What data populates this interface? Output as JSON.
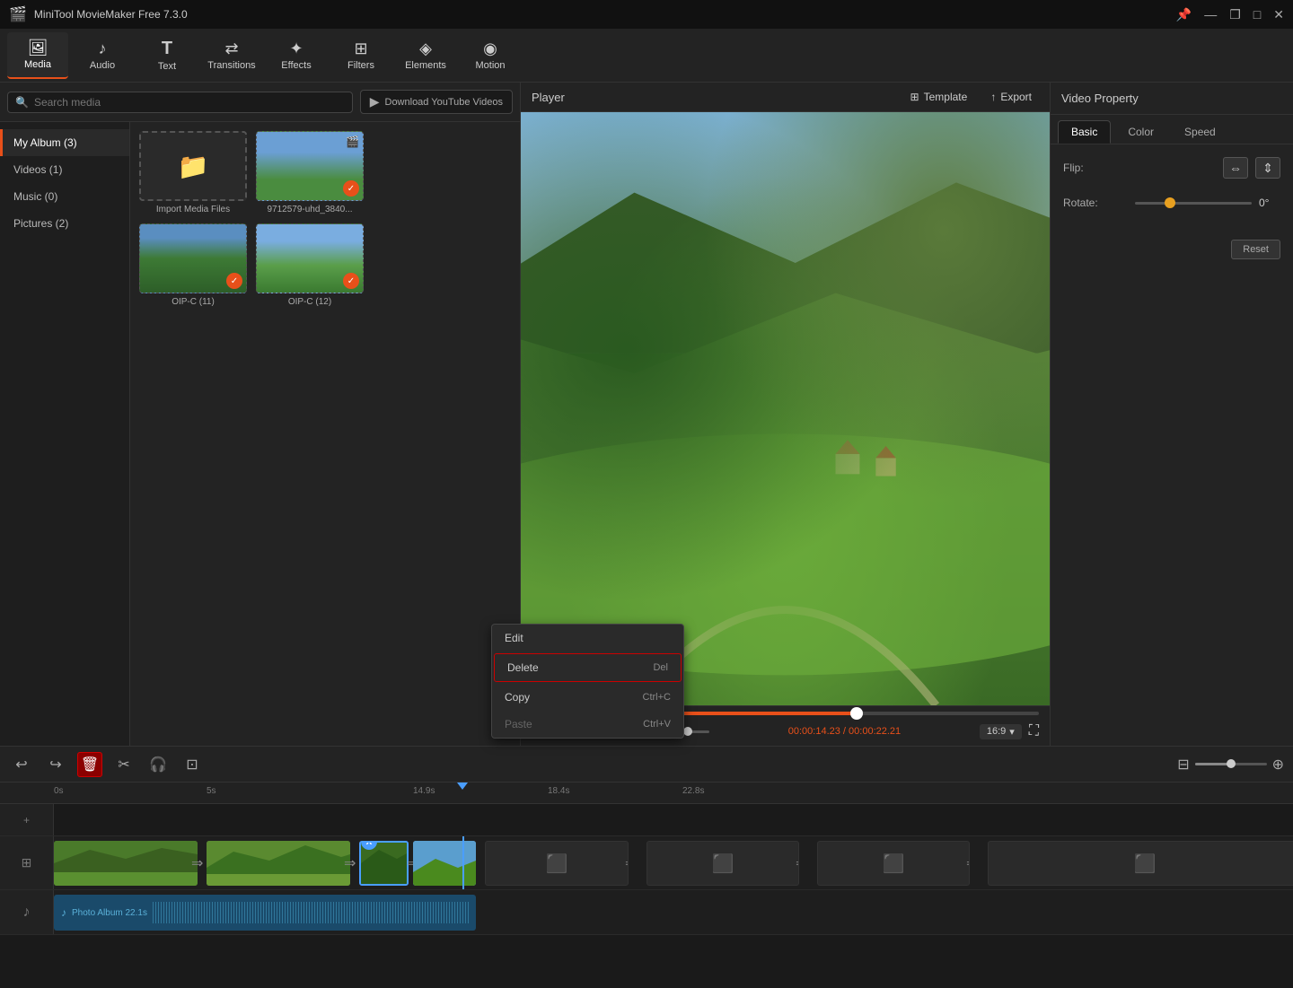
{
  "app": {
    "title": "MiniTool MovieMaker Free 7.3.0",
    "icon": "🎬"
  },
  "titlebar": {
    "minimize": "—",
    "maximize": "□",
    "restore": "❐",
    "close": "✕",
    "pin_icon": "📌"
  },
  "toolbar": {
    "items": [
      {
        "id": "media",
        "label": "Media",
        "icon": "🖼"
      },
      {
        "id": "audio",
        "label": "Audio",
        "icon": "♪"
      },
      {
        "id": "text",
        "label": "Text",
        "icon": "T"
      },
      {
        "id": "transitions",
        "label": "Transitions",
        "icon": "⇄"
      },
      {
        "id": "effects",
        "label": "Effects",
        "icon": "✦"
      },
      {
        "id": "filters",
        "label": "Filters",
        "icon": "⊞"
      },
      {
        "id": "elements",
        "label": "Elements",
        "icon": "◈"
      },
      {
        "id": "motion",
        "label": "Motion",
        "icon": "◉"
      }
    ]
  },
  "search": {
    "placeholder": "Search media"
  },
  "download_yt": {
    "label": "Download YouTube Videos",
    "icon": "▶"
  },
  "sidebar": {
    "items": [
      {
        "id": "my-album",
        "label": "My Album (3)"
      },
      {
        "id": "videos",
        "label": "Videos (1)"
      },
      {
        "id": "music",
        "label": "Music (0)"
      },
      {
        "id": "pictures",
        "label": "Pictures (2)"
      }
    ]
  },
  "media_items": [
    {
      "id": "import",
      "label": "Import Media Files",
      "type": "import"
    },
    {
      "id": "video1",
      "label": "9712579-uhd_3840...",
      "type": "video",
      "checked": true
    },
    {
      "id": "img1",
      "label": "OIP-C (11)",
      "type": "image",
      "checked": true
    },
    {
      "id": "img2",
      "label": "OIP-C (12)",
      "type": "image",
      "checked": true
    }
  ],
  "player": {
    "label": "Player",
    "template_btn": "Template",
    "export_btn": "Export",
    "time_current": "00:00:14.23",
    "time_total": "00:00:22.21",
    "aspect_ratio": "16:9",
    "progress_percent": 64
  },
  "video_property": {
    "title": "Video Property",
    "tabs": [
      "Basic",
      "Color",
      "Speed"
    ],
    "flip_label": "Flip:",
    "rotate_label": "Rotate:",
    "rotate_value": "0°",
    "reset_label": "Reset"
  },
  "timeline": {
    "undo": "↩",
    "redo": "↪",
    "delete": "🗑",
    "cut": "✂",
    "audio_edit": "🎧",
    "crop": "⊡",
    "time_marks": [
      "0s",
      "5s",
      "14.9s",
      "18.4s",
      "22.8s"
    ]
  },
  "context_menu": {
    "items": [
      {
        "label": "Edit",
        "shortcut": "",
        "disabled": false,
        "id": "edit"
      },
      {
        "label": "Delete",
        "shortcut": "Del",
        "disabled": false,
        "id": "delete",
        "highlighted": true
      },
      {
        "label": "Copy",
        "shortcut": "Ctrl+C",
        "disabled": false,
        "id": "copy"
      },
      {
        "label": "Paste",
        "shortcut": "Ctrl+V",
        "disabled": true,
        "id": "paste"
      }
    ]
  },
  "audio_track": {
    "icon": "♪",
    "label": "Photo Album",
    "duration": "22.1s"
  }
}
